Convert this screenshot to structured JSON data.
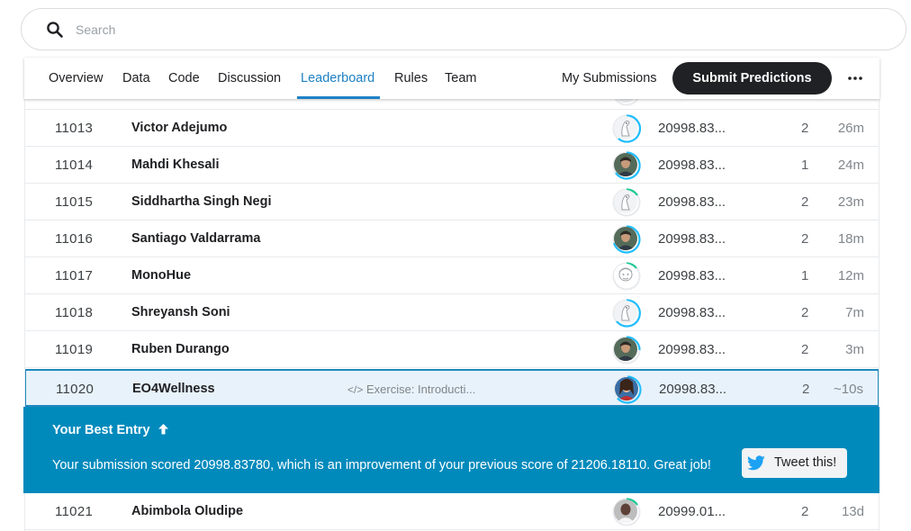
{
  "search": {
    "placeholder": "Search"
  },
  "nav": {
    "tabs": [
      {
        "label": "Overview"
      },
      {
        "label": "Data"
      },
      {
        "label": "Code"
      },
      {
        "label": "Discussion"
      },
      {
        "label": "Leaderboard",
        "active": true
      },
      {
        "label": "Rules"
      },
      {
        "label": "Team"
      }
    ],
    "my_submissions": "My Submissions",
    "submit_label": "Submit Predictions",
    "more_icon": "more-horizontal-icon"
  },
  "leaderboard": {
    "rows": [
      {
        "rank": "11013",
        "team": "Victor Adejumo",
        "score": "20998.83...",
        "entries": "2",
        "last": "26m",
        "avatar": "default-avatar"
      },
      {
        "rank": "11014",
        "team": "Mahdi Khesali",
        "score": "20998.83...",
        "entries": "1",
        "last": "24m",
        "avatar": "photo-avatar"
      },
      {
        "rank": "11015",
        "team": "Siddhartha Singh Negi",
        "score": "20998.83...",
        "entries": "2",
        "last": "23m",
        "avatar": "default-avatar"
      },
      {
        "rank": "11016",
        "team": "Santiago Valdarrama",
        "score": "20998.83...",
        "entries": "2",
        "last": "18m",
        "avatar": "photo-avatar"
      },
      {
        "rank": "11017",
        "team": "MonoHue",
        "score": "20998.83...",
        "entries": "1",
        "last": "12m",
        "avatar": "sketch-avatar"
      },
      {
        "rank": "11018",
        "team": "Shreyansh Soni",
        "score": "20998.83...",
        "entries": "2",
        "last": "7m",
        "avatar": "default-avatar"
      },
      {
        "rank": "11019",
        "team": "Ruben Durango",
        "score": "20998.83...",
        "entries": "2",
        "last": "3m",
        "avatar": "photo-avatar"
      }
    ],
    "current": {
      "rank": "11020",
      "team": "EO4Wellness",
      "kernel": "Exercise: Introducti...",
      "score": "20998.83...",
      "entries": "2",
      "last": "~10s",
      "avatar": "photo-avatar"
    },
    "after": [
      {
        "rank": "11021",
        "team": "Abimbola Oludipe",
        "score": "20999.01...",
        "entries": "2",
        "last": "13d",
        "avatar": "photo-avatar"
      }
    ]
  },
  "banner": {
    "title": "Your Best Entry",
    "message": "Your submission scored 20998.83780, which is an improvement of your previous score of 21206.18110. Great job!",
    "tweet_label": "Tweet this!"
  },
  "colors": {
    "accent": "#1e81c5",
    "banner": "#008abc",
    "highlight_row": "#e8f2fa",
    "submit_button": "#202124",
    "ring": "#20beff"
  }
}
